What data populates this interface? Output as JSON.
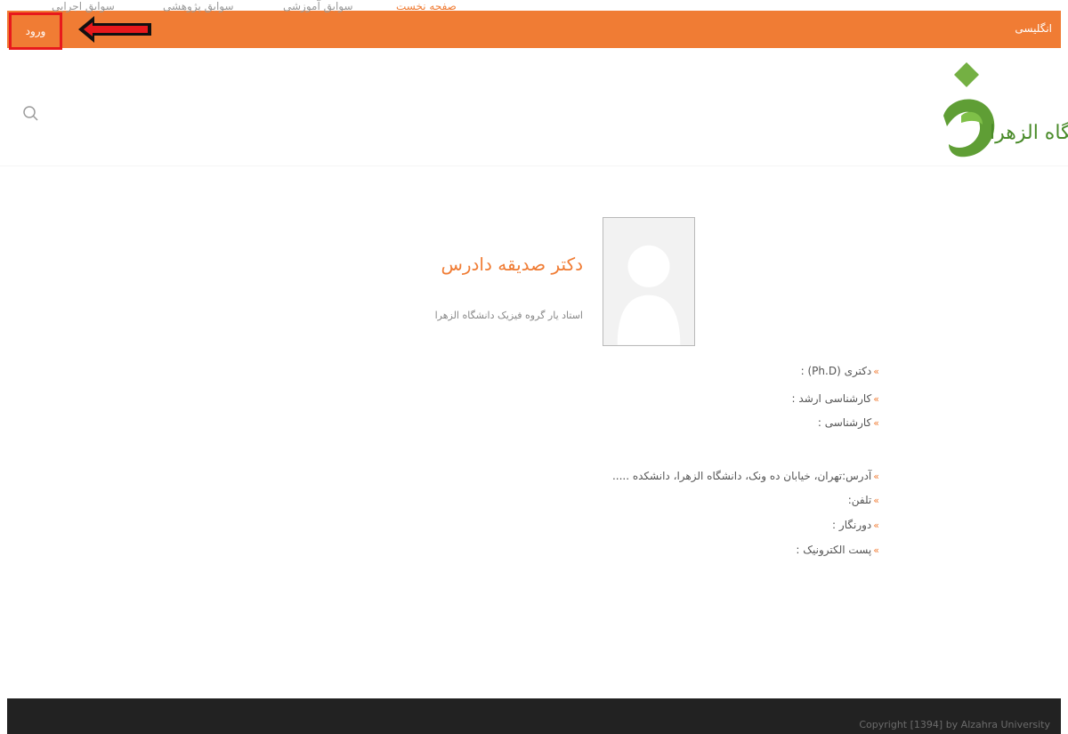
{
  "topbar": {
    "login_label": "ورود",
    "language_label": "انگلیسی",
    "color": "#f07c34"
  },
  "logo": {
    "alt": "دانشگاه الزهرا"
  },
  "nav": {
    "items": [
      {
        "label": "صفحه نخست",
        "active": true
      },
      {
        "label": "سوابق آموزشی",
        "active": false
      },
      {
        "label": "سوابق پژوهشی",
        "active": false
      },
      {
        "label": "سوابق اجرایی",
        "active": false
      }
    ],
    "search_icon": "search-icon"
  },
  "profile": {
    "name": "دکتر صدیقه دادرس",
    "title": "استاد یار گروه فیزیک دانشگاه الزهرا"
  },
  "education": {
    "phd": "دکتری (Ph.D) :",
    "masters": "کارشناسی ارشد :",
    "bachelors": "کارشناسی :"
  },
  "contact": {
    "address": "آدرس:تهران، خیابان ده ونک، دانشگاه الزهرا، دانشکده .....",
    "phone": "تلفن:",
    "fax": "دورنگار :",
    "email": "پست الکترونیک :"
  },
  "footer": {
    "copyright": "Copyright [1394] by Alzahra University"
  }
}
